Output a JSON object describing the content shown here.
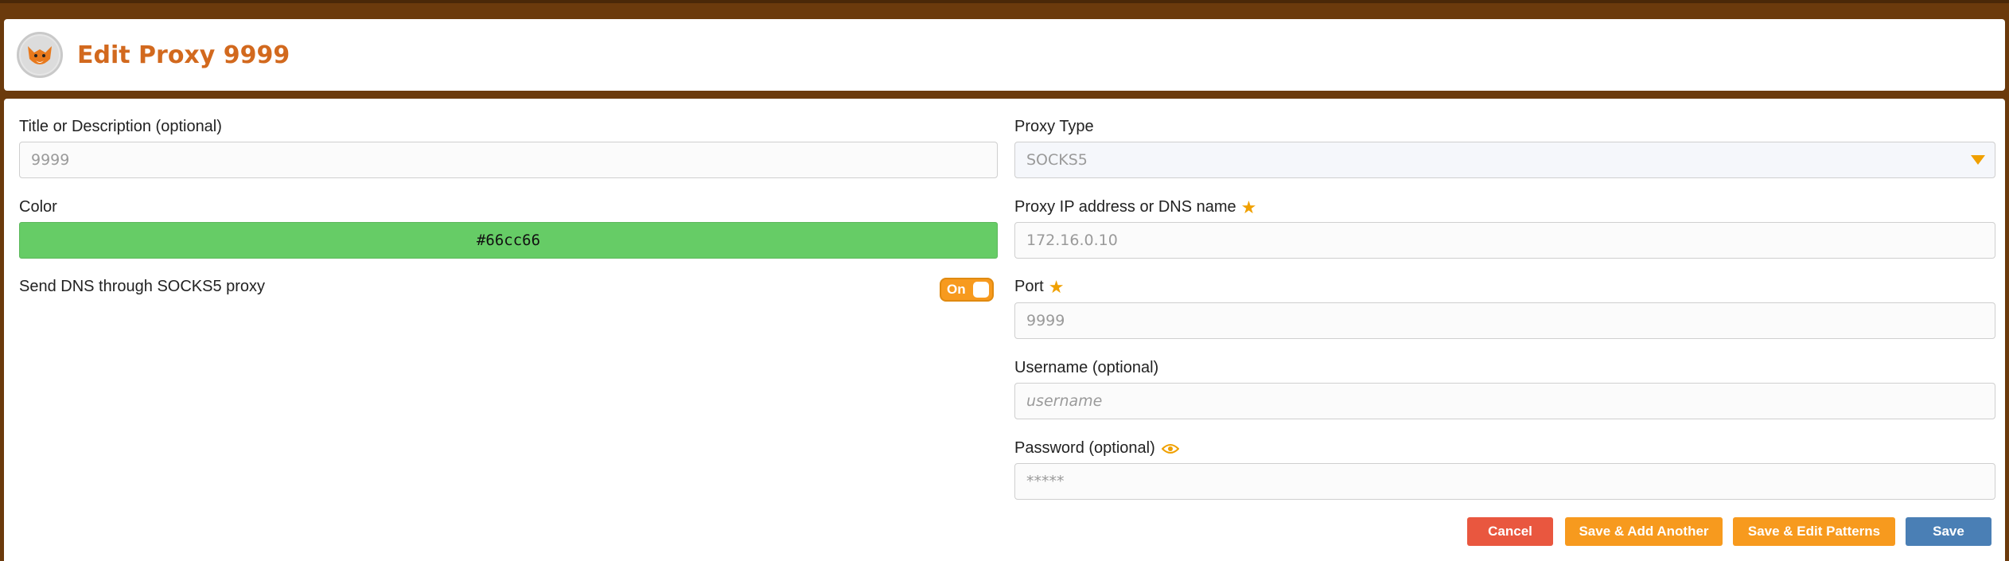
{
  "header": {
    "title": "Edit Proxy 9999",
    "logo_icon": "foxyproxy-fox-logo"
  },
  "form": {
    "title_label": "Title or Description (optional)",
    "title_value": "9999",
    "color_label": "Color",
    "color_value": "#66cc66",
    "dns_label": "Send DNS through SOCKS5 proxy",
    "dns_toggle": "On",
    "proxy_type_label": "Proxy Type",
    "proxy_type_value": "SOCKS5",
    "host_label": "Proxy IP address or DNS name",
    "host_value": "172.16.0.10",
    "port_label": "Port",
    "port_value": "9999",
    "username_label": "Username (optional)",
    "username_placeholder": "username",
    "password_label": "Password (optional)",
    "password_placeholder": "*****"
  },
  "buttons": {
    "cancel": "Cancel",
    "save_add": "Save & Add Another",
    "save_patterns": "Save & Edit Patterns",
    "save": "Save"
  },
  "colors": {
    "accent": "#f79a1e",
    "title": "#d2691e",
    "background": "#6b3a0c",
    "cancel": "#e9573f",
    "save": "#4a7fb5",
    "swatch": "#66cc66"
  }
}
